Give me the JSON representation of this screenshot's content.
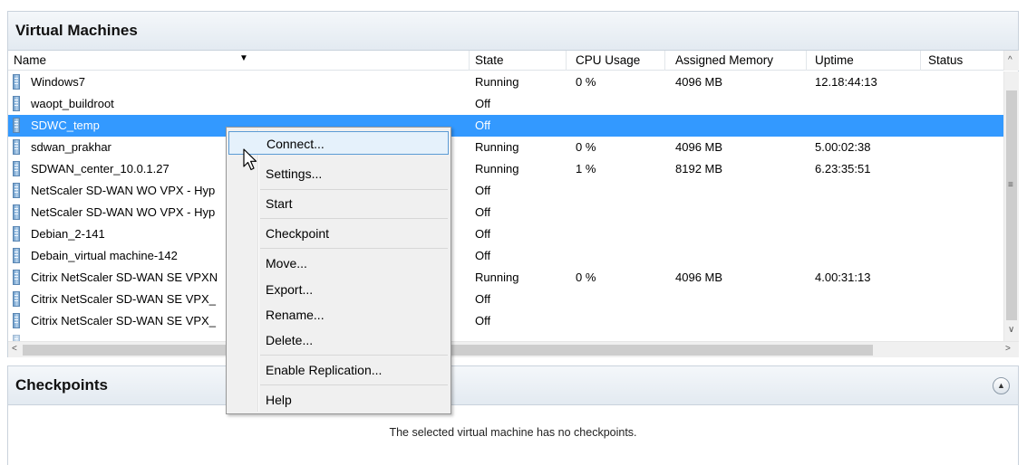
{
  "vm_panel": {
    "title": "Virtual Machines",
    "columns": [
      "Name",
      "State",
      "CPU Usage",
      "Assigned Memory",
      "Uptime",
      "Status"
    ],
    "rows": [
      {
        "name": "Windows7",
        "state": "Running",
        "cpu": "0 %",
        "memory": "4096 MB",
        "uptime": "12.18:44:13",
        "status": ""
      },
      {
        "name": "waopt_buildroot",
        "state": "Off",
        "cpu": "",
        "memory": "",
        "uptime": "",
        "status": ""
      },
      {
        "name": "SDWC_temp",
        "state": "Off",
        "cpu": "",
        "memory": "",
        "uptime": "",
        "status": ""
      },
      {
        "name": "sdwan_prakhar",
        "state": "Running",
        "cpu": "0 %",
        "memory": "4096 MB",
        "uptime": "5.00:02:38",
        "status": ""
      },
      {
        "name": "SDWAN_center_10.0.1.27",
        "state": "Running",
        "cpu": "1 %",
        "memory": "8192 MB",
        "uptime": "6.23:35:51",
        "status": ""
      },
      {
        "name": "NetScaler SD-WAN WO VPX - Hyp",
        "state": "Off",
        "cpu": "",
        "memory": "",
        "uptime": "",
        "status": ""
      },
      {
        "name": "NetScaler SD-WAN WO VPX - Hyp",
        "state": "Off",
        "cpu": "",
        "memory": "",
        "uptime": "",
        "status": ""
      },
      {
        "name": "Debian_2-141",
        "state": "Off",
        "cpu": "",
        "memory": "",
        "uptime": "",
        "status": ""
      },
      {
        "name": "Debain_virtual machine-142",
        "state": "Off",
        "cpu": "",
        "memory": "",
        "uptime": "",
        "status": ""
      },
      {
        "name": "Citrix NetScaler SD-WAN SE VPXN",
        "state": "Running",
        "cpu": "0 %",
        "memory": "4096 MB",
        "uptime": "4.00:31:13",
        "status": ""
      },
      {
        "name": "Citrix NetScaler SD-WAN SE VPX_",
        "state": "Off",
        "cpu": "",
        "memory": "",
        "uptime": "",
        "status": ""
      },
      {
        "name": "Citrix NetScaler SD-WAN SE VPX_",
        "state": "Off",
        "cpu": "",
        "memory": "",
        "uptime": "",
        "status": ""
      }
    ],
    "selected_row": 2
  },
  "context_menu": {
    "items": [
      "Connect...",
      "Settings...",
      "Start",
      "Checkpoint",
      "Move...",
      "Export...",
      "Rename...",
      "Delete...",
      "Enable Replication...",
      "Help"
    ],
    "highlighted": 0
  },
  "checkpoints_panel": {
    "title": "Checkpoints",
    "message": "The selected virtual machine has no checkpoints."
  },
  "icons": {
    "vm": "vm-icon",
    "sort": "sort-down-icon",
    "expand": "collapse-chevron-icon",
    "cursor": "mouse-cursor-icon"
  },
  "colors": {
    "selection": "#3399ff",
    "menu_highlight": "#e5f1fb",
    "menu_highlight_border": "#5b9bd5"
  }
}
